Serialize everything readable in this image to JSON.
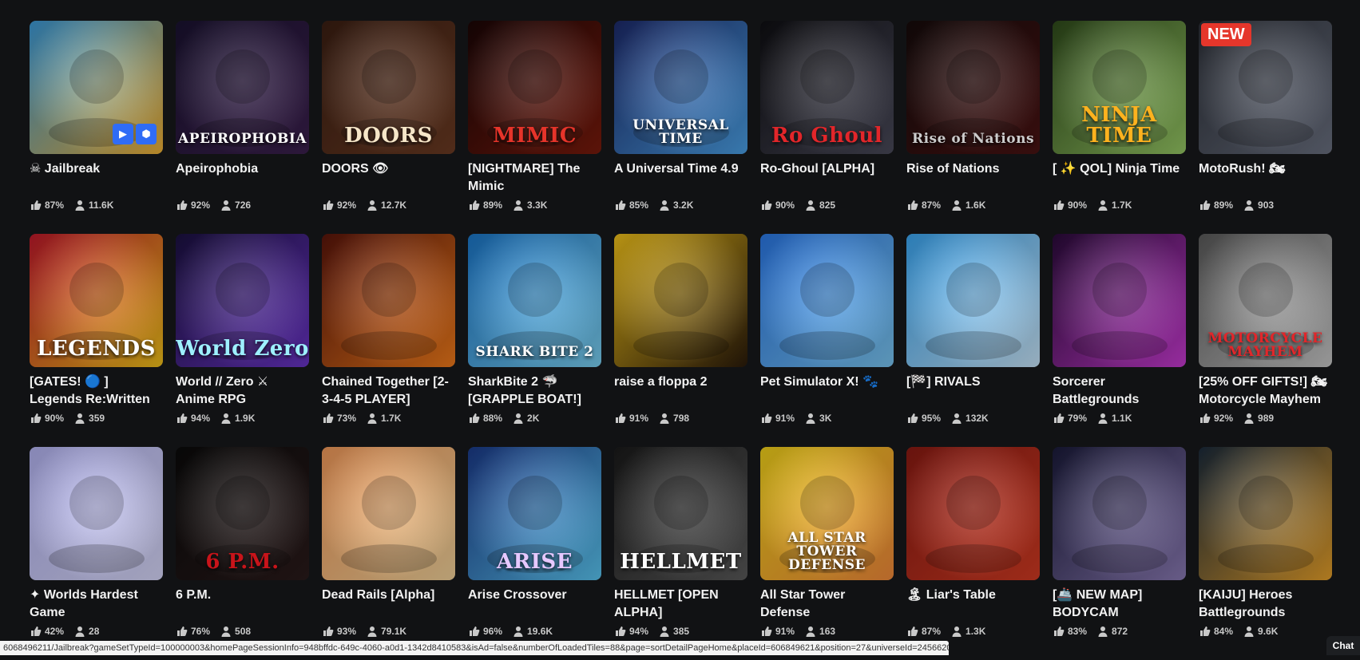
{
  "games": [
    {
      "title": "☠ Jailbreak",
      "rating": "87%",
      "players": "11.6K",
      "bg1": "#3a9ad9",
      "bg2": "#f2b233",
      "art": "",
      "art_color": "#fff",
      "badge": "",
      "play": true
    },
    {
      "title": "Apeirophobia",
      "rating": "92%",
      "players": "726",
      "bg1": "#1a1230",
      "bg2": "#3b1f4e",
      "art": "APEIROPHOBIA",
      "art_color": "#ffffff",
      "badge": "",
      "play": false
    },
    {
      "title": "DOORS 👁",
      "rating": "92%",
      "players": "12.7K",
      "bg1": "#3a1e12",
      "bg2": "#6b3a22",
      "art": "DOORS",
      "art_color": "#f6e6c8",
      "badge": "",
      "play": false
    },
    {
      "title": "[NIGHTMARE] The Mimic",
      "rating": "89%",
      "players": "3.3K",
      "bg1": "#1a0505",
      "bg2": "#7a1a0c",
      "art": "MIMIC",
      "art_color": "#e6342a",
      "badge": "",
      "play": false
    },
    {
      "title": "A Universal Time 4.9",
      "rating": "85%",
      "players": "3.2K",
      "bg1": "#1c2a6b",
      "bg2": "#4aa0e6",
      "art": "UNIVERSAL TIME",
      "art_color": "#ffffff",
      "badge": "",
      "play": false
    },
    {
      "title": "Ro-Ghoul [ALPHA]",
      "rating": "90%",
      "players": "825",
      "bg1": "#0e0e12",
      "bg2": "#4a4a5a",
      "art": "Ro Ghoul",
      "art_color": "#e2262a",
      "badge": "",
      "play": false
    },
    {
      "title": "Rise of Nations",
      "rating": "87%",
      "players": "1.6K",
      "bg1": "#150b0b",
      "bg2": "#4a1212",
      "art": "Rise of Nations",
      "art_color": "#cccccc",
      "badge": "",
      "play": false
    },
    {
      "title": "[ ✨ QOL] Ninja Time",
      "rating": "90%",
      "players": "1.7K",
      "bg1": "#2e4a1a",
      "bg2": "#96c864",
      "art": "NINJA TIME",
      "art_color": "#ffb21e",
      "badge": "",
      "play": false
    },
    {
      "title": "MotoRush! 🏍",
      "rating": "89%",
      "players": "903",
      "bg1": "#2a2e36",
      "bg2": "#6a7080",
      "art": "",
      "art_color": "#fff",
      "badge": "NEW",
      "play": false
    },
    {
      "title": "[GATES! 🔵 ] Legends Re:Written",
      "rating": "90%",
      "players": "359",
      "bg1": "#c0182a",
      "bg2": "#f2c21a",
      "art": "LEGENDS",
      "art_color": "#ffffff",
      "badge": "",
      "play": false
    },
    {
      "title": "World // Zero ⚔ Anime RPG",
      "rating": "94%",
      "players": "1.9K",
      "bg1": "#1a1040",
      "bg2": "#6a34c8",
      "art": "World Zero",
      "art_color": "#9ef0ff",
      "badge": "",
      "play": false
    },
    {
      "title": "Chained Together [2-3-4-5 PLAYER]",
      "rating": "73%",
      "players": "1.7K",
      "bg1": "#5a140a",
      "bg2": "#f07a1a",
      "art": "",
      "art_color": "#fff",
      "badge": "",
      "play": false
    },
    {
      "title": "SharkBite 2 🦈 [GRAPPLE BOAT!]",
      "rating": "88%",
      "players": "2K",
      "bg1": "#1a76c8",
      "bg2": "#7ad0f2",
      "art": "SHARK BITE 2",
      "art_color": "#ffffff",
      "badge": "",
      "play": false
    },
    {
      "title": "raise a floppa 2",
      "rating": "91%",
      "players": "798",
      "bg1": "#f2c21a",
      "bg2": "#2a1a0a",
      "art": "",
      "art_color": "#fff",
      "badge": "",
      "play": false
    },
    {
      "title": "Pet Simulator X! 🐾",
      "rating": "91%",
      "players": "3K",
      "bg1": "#2a78e6",
      "bg2": "#7ac6f2",
      "art": "",
      "art_color": "#fff",
      "badge": "",
      "play": false
    },
    {
      "title": "[🏁] RIVALS",
      "rating": "95%",
      "players": "132K",
      "bg1": "#3aa6f2",
      "bg2": "#c8e6fa",
      "art": "",
      "art_color": "#fff",
      "badge": "",
      "play": false
    },
    {
      "title": "Sorcerer Battlegrounds",
      "rating": "79%",
      "players": "1.1K",
      "bg1": "#2a0a3a",
      "bg2": "#c83ad2",
      "art": "",
      "art_color": "#fff",
      "badge": "",
      "play": false
    },
    {
      "title": "[25% OFF GIFTS!] 🏍 Motorcycle Mayhem",
      "rating": "92%",
      "players": "989",
      "bg1": "#5a5a5a",
      "bg2": "#c8c8c8",
      "art": "MOTORCYCLE MAYHEM",
      "art_color": "#e2262a",
      "badge": "",
      "play": false
    },
    {
      "title": "✦ Worlds Hardest Game",
      "rating": "42%",
      "players": "28",
      "bg1": "#b4b4f2",
      "bg2": "#d8d8fa",
      "art": "",
      "art_color": "#fff",
      "badge": "",
      "play": false
    },
    {
      "title": "6 P.M.",
      "rating": "76%",
      "players": "508",
      "bg1": "#0a0a0a",
      "bg2": "#2a1a1a",
      "art": "6 P.M.",
      "art_color": "#c8141a",
      "badge": "",
      "play": false
    },
    {
      "title": "Dead Rails [Alpha]",
      "rating": "93%",
      "players": "79.1K",
      "bg1": "#f29a5a",
      "bg2": "#f2d29a",
      "art": "",
      "art_color": "#fff",
      "badge": "",
      "play": false
    },
    {
      "title": "Arise Crossover",
      "rating": "96%",
      "players": "19.6K",
      "bg1": "#1a3a8a",
      "bg2": "#5ac6f2",
      "art": "ARISE",
      "art_color": "#e6c8ff",
      "badge": "",
      "play": false
    },
    {
      "title": "HELLMET [OPEN ALPHA]",
      "rating": "94%",
      "players": "385",
      "bg1": "#1a1a1a",
      "bg2": "#5a5a5a",
      "art": "HELLMET",
      "art_color": "#ffffff",
      "badge": "",
      "play": false
    },
    {
      "title": "All Star Tower Defense",
      "rating": "91%",
      "players": "163",
      "bg1": "#f2d21a",
      "bg2": "#f28a3a",
      "art": "ALL STAR TOWER DEFENSE",
      "art_color": "#ffffff",
      "badge": "",
      "play": false
    },
    {
      "title": "🏝 Liar's Table",
      "rating": "87%",
      "players": "1.3K",
      "bg1": "#8a1a12",
      "bg2": "#d23a22",
      "art": "",
      "art_color": "#fff",
      "badge": "",
      "play": false
    },
    {
      "title": "[🚢 NEW MAP] BODYCAM",
      "rating": "83%",
      "players": "872",
      "bg1": "#1a1a3a",
      "bg2": "#8a7ab4",
      "art": "",
      "art_color": "#fff",
      "badge": "",
      "play": false
    },
    {
      "title": "[KAIJU] Heroes Battlegrounds",
      "rating": "84%",
      "players": "9.6K",
      "bg1": "#1a2a3a",
      "bg2": "#e6a02a",
      "art": "",
      "art_color": "#fff",
      "badge": "",
      "play": false
    }
  ],
  "status_url": "6068496211/Jailbreak?gameSetTypeId=100000003&homePageSessionInfo=948bffdc-649c-4060-a0d1-1342d8410583&isAd=false&numberOfLoadedTiles=88&page=sortDetailPageHome&placeId=606849621&position=27&universeId=245662005",
  "chat_label": "Chat",
  "colors": {
    "background": "#111214",
    "text": "#f2f2f2",
    "stats": "#c9c9c9"
  },
  "icons": {
    "rating": "thumbs-up-icon",
    "players": "person-icon",
    "play": "play-icon",
    "vr": "vr-cube-icon"
  }
}
